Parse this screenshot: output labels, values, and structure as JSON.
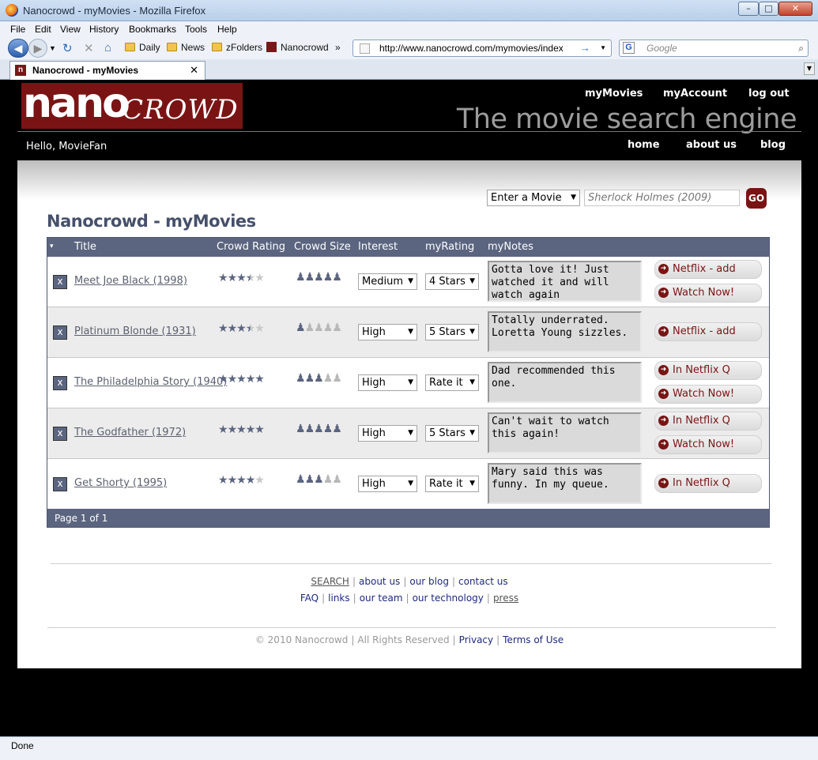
{
  "window": {
    "title": "Nanocrowd - myMovies - Mozilla Firefox"
  },
  "menu": [
    "File",
    "Edit",
    "View",
    "History",
    "Bookmarks",
    "Tools",
    "Help"
  ],
  "bookmarks": [
    "Daily",
    "News",
    "zFolders",
    "Nanocrowd"
  ],
  "address": {
    "url": "http://www.nanocrowd.com/mymovies/index"
  },
  "search_box": {
    "placeholder": "Google"
  },
  "tab": {
    "title": "Nanocrowd - myMovies"
  },
  "status": "Done",
  "site": {
    "logo_part1": "nano",
    "logo_part2": "CROWD",
    "top_links": [
      "myMovies",
      "myAccount",
      "log out"
    ],
    "tagline": "The movie search engine",
    "greeting": "Hello, MovieFan",
    "nav": [
      "home",
      "about us",
      "blog"
    ],
    "search_select": "Enter a Movie",
    "search_placeholder": "Sherlock Holmes (2009)",
    "go": "GO"
  },
  "page_title": "Nanocrowd - myMovies",
  "table": {
    "sort_marker": "▾",
    "headers": [
      "Title",
      "Crowd Rating",
      "Crowd Size",
      "Interest",
      "myRating",
      "myNotes"
    ],
    "rows": [
      {
        "remove": "x",
        "title": "Meet Joe Black (1998)",
        "rating": 3.5,
        "crowd_size": 5,
        "interest": "Medium",
        "my_rating": "4 Stars",
        "notes": "Gotta love it! Just watched it and will watch again",
        "actions": [
          "Netflix - add",
          "Watch Now!"
        ]
      },
      {
        "remove": "x",
        "title": "Platinum Blonde (1931)",
        "rating": 3.5,
        "crowd_size": 1,
        "interest": "High",
        "my_rating": "5 Stars",
        "notes": "Totally underrated. Loretta Young sizzles.",
        "actions": [
          "Netflix - add"
        ]
      },
      {
        "remove": "x",
        "title": "The Philadelphia Story (1940)",
        "rating": 5,
        "crowd_size": 3,
        "interest": "High",
        "my_rating": "Rate it",
        "notes": "Dad recommended this one.",
        "actions": [
          "In Netflix Q",
          "Watch Now!"
        ]
      },
      {
        "remove": "x",
        "title": "The Godfather (1972)",
        "rating": 5,
        "crowd_size": 5,
        "interest": "High",
        "my_rating": "5 Stars",
        "notes": "Can't wait to watch this again!",
        "actions": [
          "In Netflix Q",
          "Watch Now!"
        ]
      },
      {
        "remove": "x",
        "title": "Get Shorty (1995)",
        "rating": 4,
        "crowd_size": 3,
        "interest": "High",
        "my_rating": "Rate it",
        "notes": "Mary said this was funny. In my queue.",
        "actions": [
          "In Netflix Q"
        ]
      }
    ],
    "pager": "Page 1 of 1"
  },
  "footer": {
    "row1": [
      "SEARCH",
      "about us",
      "our blog",
      "contact us"
    ],
    "row2": [
      "FAQ",
      "links",
      "our team",
      "our technology",
      "press"
    ],
    "copyright": "© 2010 Nanocrowd",
    "rights": "All Rights Reserved",
    "legal": [
      "Privacy",
      "Terms of Use"
    ]
  },
  "colors": {
    "brand": "#7a1414",
    "table_header": "#5b6580",
    "title": "#46506a"
  }
}
